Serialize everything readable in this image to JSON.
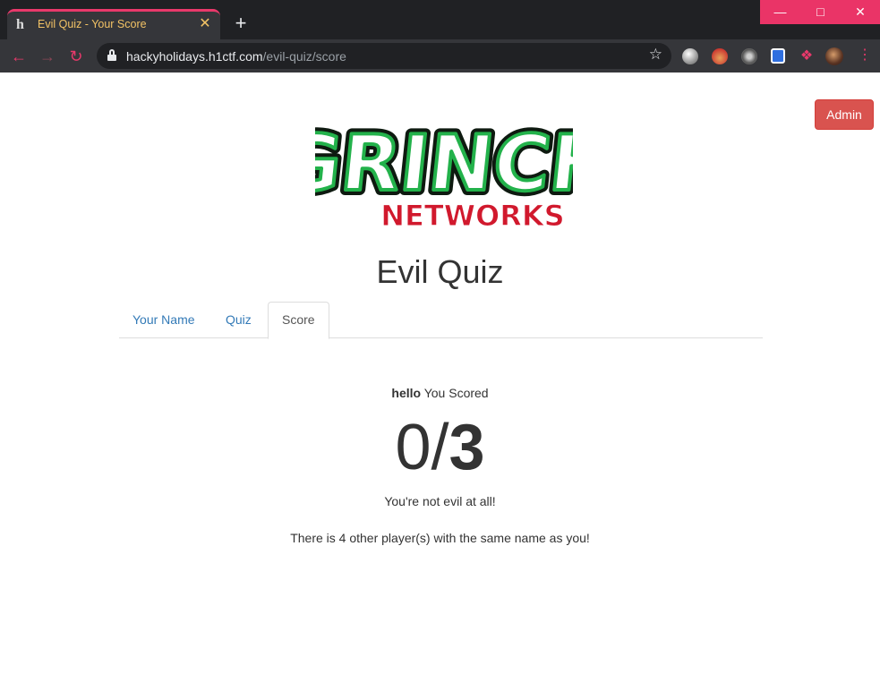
{
  "browser": {
    "tab_title": "Evil Quiz - Your Score",
    "tab_favicon": "h",
    "url_host": "hackyholidays.h1ctf.com",
    "url_path": "/evil-quiz/score",
    "accent_color": "#e9396b",
    "icons": {
      "back": "back-arrow-icon",
      "forward": "forward-arrow-icon",
      "reload": "reload-icon",
      "lock": "lock-icon",
      "bookmark": "star-icon",
      "extensions": "puzzle-icon",
      "menu": "kebab-menu-icon"
    }
  },
  "header": {
    "admin_label": "Admin",
    "admin_color": "#d9534f",
    "logo": {
      "line1": "GRINCH",
      "line2": "NETWORKS",
      "green": "#23b24b",
      "red": "#d1192d"
    }
  },
  "page": {
    "title": "Evil Quiz",
    "tabs": [
      {
        "label": "Your Name",
        "active": false
      },
      {
        "label": "Quiz",
        "active": false
      },
      {
        "label": "Score",
        "active": true
      }
    ]
  },
  "score": {
    "player_name": "hello",
    "scored_text": "You Scored",
    "correct": "0",
    "separator": "/",
    "total": "3",
    "verdict": "You're not evil at all!",
    "others_message": "There is 4 other player(s) with the same name as you!"
  }
}
